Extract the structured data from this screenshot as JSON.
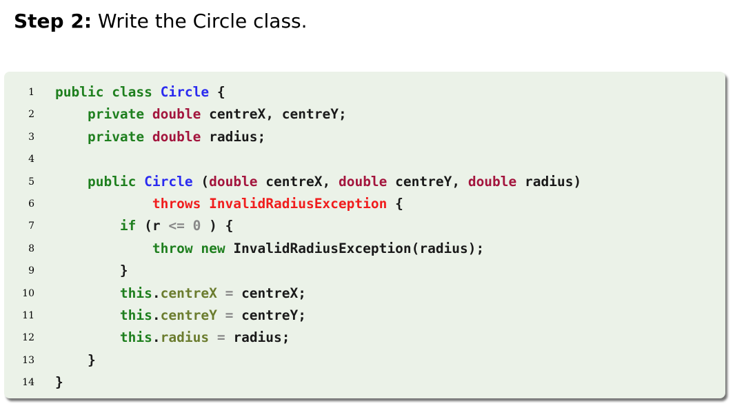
{
  "heading": {
    "step_label": "Step 2:",
    "text": " Write the Circle class."
  },
  "code": {
    "language": "java",
    "lines": [
      {
        "n": "1",
        "tokens": [
          {
            "t": "public",
            "c": "kw"
          },
          {
            "t": " "
          },
          {
            "t": "class",
            "c": "kw"
          },
          {
            "t": " "
          },
          {
            "t": "Circle",
            "c": "cl"
          },
          {
            "t": " {"
          }
        ]
      },
      {
        "n": "2",
        "tokens": [
          {
            "t": "    "
          },
          {
            "t": "private",
            "c": "kw"
          },
          {
            "t": " "
          },
          {
            "t": "double",
            "c": "ty"
          },
          {
            "t": " centreX, centreY;"
          }
        ]
      },
      {
        "n": "3",
        "tokens": [
          {
            "t": "    "
          },
          {
            "t": "private",
            "c": "kw"
          },
          {
            "t": " "
          },
          {
            "t": "double",
            "c": "ty"
          },
          {
            "t": " radius;"
          }
        ]
      },
      {
        "n": "4",
        "tokens": []
      },
      {
        "n": "5",
        "tokens": [
          {
            "t": "    "
          },
          {
            "t": "public",
            "c": "kw"
          },
          {
            "t": " "
          },
          {
            "t": "Circle",
            "c": "cl"
          },
          {
            "t": " ("
          },
          {
            "t": "double",
            "c": "ty"
          },
          {
            "t": " centreX, "
          },
          {
            "t": "double",
            "c": "ty"
          },
          {
            "t": " centreY, "
          },
          {
            "t": "double",
            "c": "ty"
          },
          {
            "t": " radius)"
          }
        ]
      },
      {
        "n": "6",
        "tokens": [
          {
            "t": "            "
          },
          {
            "t": "throws InvalidRadiusException",
            "c": "ex"
          },
          {
            "t": " {"
          }
        ]
      },
      {
        "n": "7",
        "tokens": [
          {
            "t": "        "
          },
          {
            "t": "if",
            "c": "kw"
          },
          {
            "t": " (r "
          },
          {
            "t": "<=",
            "c": "op"
          },
          {
            "t": " "
          },
          {
            "t": "0",
            "c": "op"
          },
          {
            "t": " ) {"
          }
        ]
      },
      {
        "n": "8",
        "tokens": [
          {
            "t": "            "
          },
          {
            "t": "throw",
            "c": "kw"
          },
          {
            "t": " "
          },
          {
            "t": "new",
            "c": "kw"
          },
          {
            "t": " InvalidRadiusException(radius);"
          }
        ]
      },
      {
        "n": "9",
        "tokens": [
          {
            "t": "        }"
          }
        ]
      },
      {
        "n": "10",
        "tokens": [
          {
            "t": "        "
          },
          {
            "t": "this",
            "c": "kw"
          },
          {
            "t": "."
          },
          {
            "t": "centreX",
            "c": "fd"
          },
          {
            "t": " "
          },
          {
            "t": "=",
            "c": "op"
          },
          {
            "t": " centreX;"
          }
        ]
      },
      {
        "n": "11",
        "tokens": [
          {
            "t": "        "
          },
          {
            "t": "this",
            "c": "kw"
          },
          {
            "t": "."
          },
          {
            "t": "centreY",
            "c": "fd"
          },
          {
            "t": " "
          },
          {
            "t": "=",
            "c": "op"
          },
          {
            "t": " centreY;"
          }
        ]
      },
      {
        "n": "12",
        "tokens": [
          {
            "t": "        "
          },
          {
            "t": "this",
            "c": "kw"
          },
          {
            "t": "."
          },
          {
            "t": "radius",
            "c": "fd"
          },
          {
            "t": " "
          },
          {
            "t": "=",
            "c": "op"
          },
          {
            "t": " radius;"
          }
        ]
      },
      {
        "n": "13",
        "tokens": [
          {
            "t": "    }"
          }
        ]
      },
      {
        "n": "14",
        "tokens": [
          {
            "t": "}"
          }
        ]
      }
    ]
  }
}
